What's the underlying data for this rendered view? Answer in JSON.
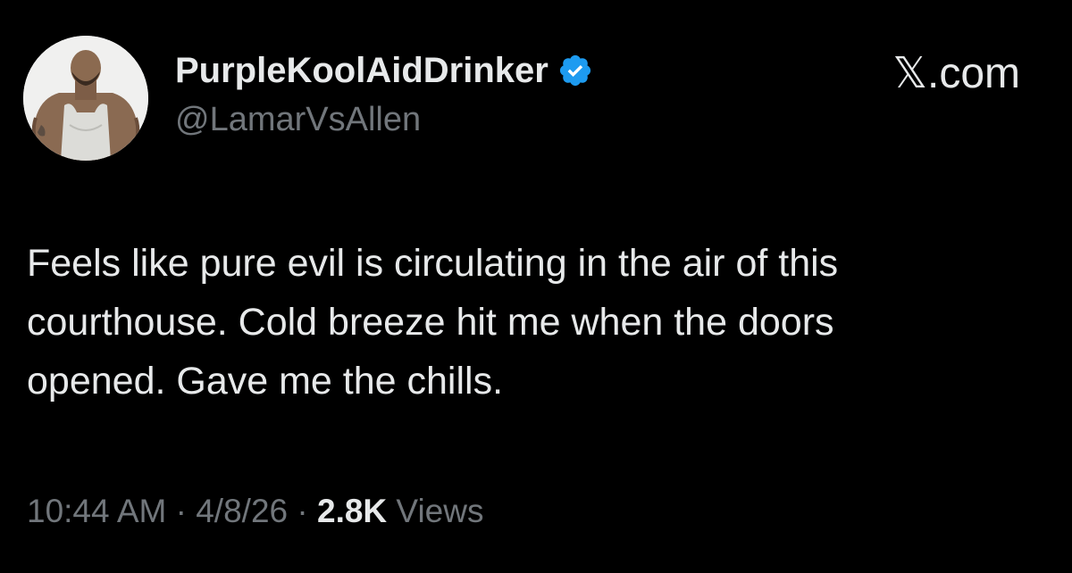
{
  "author": {
    "display_name": "PurpleKoolAidDrinker",
    "handle": "@LamarVsAllen",
    "verified": true,
    "verified_color": "#1d9bf0",
    "avatar_icon": "profile-photo"
  },
  "site": {
    "label": "𝕏.com"
  },
  "tweet": {
    "lines": [
      "Feels like pure evil is circulating in the air of this",
      "courthouse. Cold breeze hit me when the doors",
      "opened. Gave me the chills."
    ]
  },
  "meta": {
    "time": "10:44 AM",
    "sep1": " · ",
    "date": "4/8/26",
    "sep2": " · ",
    "views_count": "2.8K",
    "views_label": " Views"
  },
  "colors": {
    "background": "#000000",
    "primary_text": "#e7e9ea",
    "secondary_text": "#71767b"
  }
}
